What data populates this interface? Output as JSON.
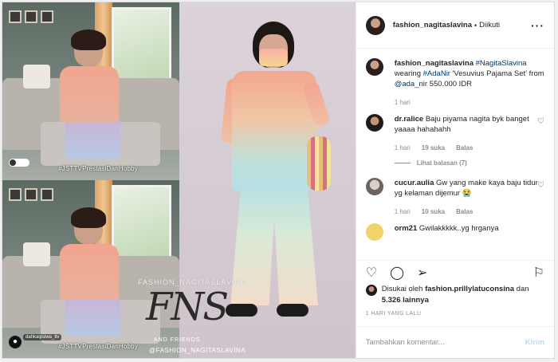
{
  "colors": {
    "link": "#00376b",
    "muted": "#8e8e8e",
    "post_button": "#b2dffc"
  },
  "post": {
    "hashtag_top": "#JSTTVPrestasiDanHobby",
    "hashtag_bottom": "#JSTTVPrestasiDanHobby",
    "user_chip": "dahkalpsiwa_tlv",
    "watermark_top": "FASHION_NAGITASLAVINA",
    "watermark_logo": "FNS",
    "watermark_sub": "AND FRIENDS",
    "watermark_bottom": "@FASHION_NAGITASLAVINA"
  },
  "header": {
    "username": "fashion_nagitaslavina",
    "dot": "•",
    "follow_label": "Diikuti",
    "more_icon": "more-horizontal-icon"
  },
  "caption": {
    "username": "fashion_nagitaslavina",
    "tag1": "#NagitaSlavina",
    "text1": "wearing",
    "tag2": "#AdaNir",
    "text2": "'Vesuvius Pajama Set' from",
    "mention": "@ada_nir",
    "text3": "550.000 IDR",
    "time": "1 hari"
  },
  "comments": [
    {
      "username": "dr.ralice",
      "text": "Baju piyama nagita byk banget yaaaa hahahahh",
      "time": "1 hari",
      "likes": "19 suka",
      "reply_label": "Balas",
      "view_replies": "Lihat balasan (7)"
    },
    {
      "username": "cucur.aulia",
      "text": "Gw yang make kaya baju tidur yg kelaman dijemur 😭",
      "time": "1 hari",
      "likes": "10 suka",
      "reply_label": "Balas"
    },
    {
      "username": "orm21",
      "text": "Gwilakkkkk..yg hrganya"
    }
  ],
  "likes": {
    "prefix": "Disukai oleh",
    "user": "fashion.prillylatuconsina",
    "joiner": "dan",
    "others": "5.326 lainnya"
  },
  "timestamp": "1 HARI YANG LALU",
  "composer": {
    "placeholder": "Tambahkan komentar...",
    "post_label": "Kirim"
  }
}
